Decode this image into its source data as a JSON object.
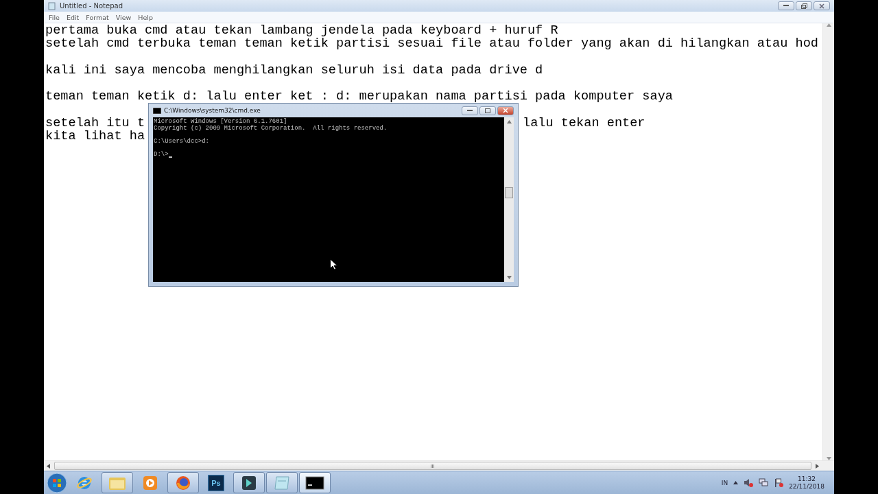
{
  "notepad": {
    "title": "Untitled - Notepad",
    "menu": [
      "File",
      "Edit",
      "Format",
      "View",
      "Help"
    ],
    "paragraphs": [
      {
        "lines": [
          {
            "segments": [
              "pertama buka cmd atau tekan lambang jendela pada keyboard + huruf R"
            ]
          },
          {
            "segments": [
              "setelah cmd terbuka teman teman ketik partisi sesuai file atau folder yang akan di hilangkan atau hod"
            ]
          }
        ]
      },
      {
        "lines": [
          {
            "segments": [
              "kali ini saya mencoba menghilangkan seluruh isi data pada drive d"
            ]
          }
        ]
      },
      {
        "lines": [
          {
            "segments": [
              "teman teman ketik d: lalu enter ket : d: merupakan nama partisi pada komputer saya"
            ]
          }
        ]
      },
      {
        "lines": [
          {
            "segments": [
              "setelah itu t",
              "lalu tekan enter"
            ]
          },
          {
            "segments": [
              "kita lihat ha"
            ]
          }
        ]
      }
    ]
  },
  "cmd": {
    "title": "C:\\Windows\\system32\\cmd.exe",
    "blocks": [
      [
        "Microsoft Windows [Version 6.1.7601]",
        "Copyright (c) 2009 Microsoft Corporation.  All rights reserved."
      ],
      [
        "C:\\Users\\dcc>d:"
      ],
      [
        "D:\\>"
      ]
    ]
  },
  "taskbar": {
    "apps": [
      {
        "kind": "ie",
        "open": false,
        "selected": false
      },
      {
        "kind": "folder",
        "open": true,
        "selected": false
      },
      {
        "kind": "media",
        "open": false,
        "selected": false
      },
      {
        "kind": "firefox",
        "open": true,
        "selected": false
      },
      {
        "kind": "ps",
        "label": "Ps",
        "open": false,
        "selected": false
      },
      {
        "kind": "editor",
        "open": true,
        "selected": false
      },
      {
        "kind": "notepad",
        "open": true,
        "selected": false
      },
      {
        "kind": "cmd",
        "open": true,
        "selected": true
      }
    ],
    "language": "IN",
    "time": "11:32",
    "date": "22/11/2018"
  }
}
